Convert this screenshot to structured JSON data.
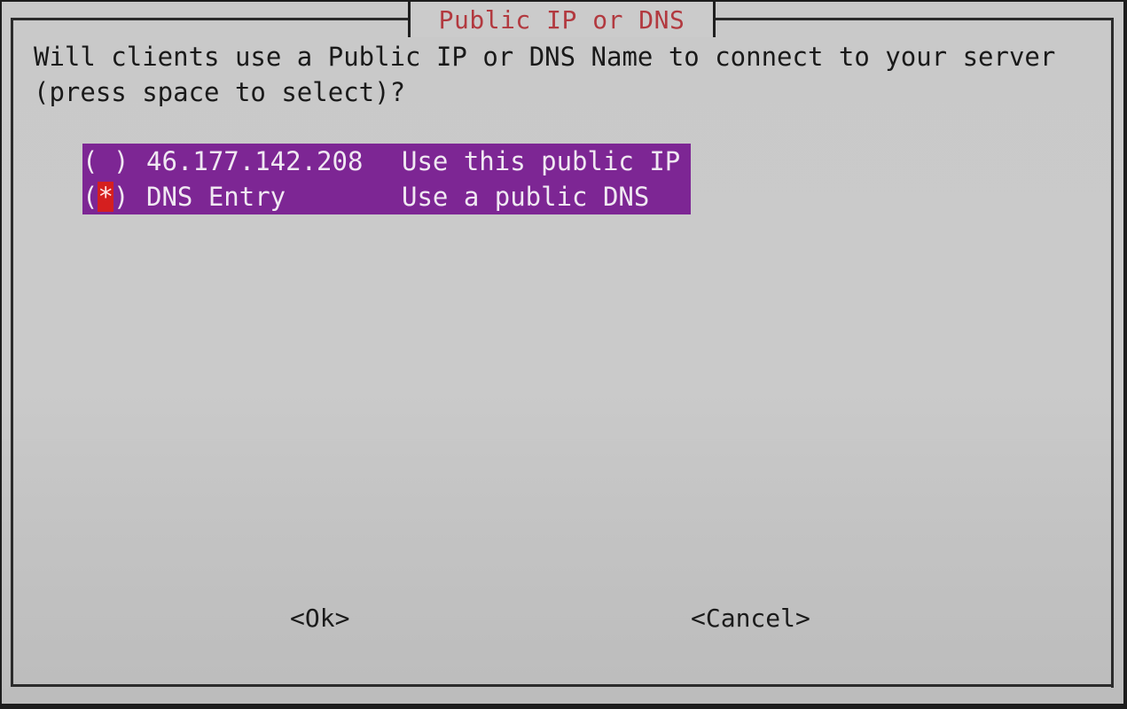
{
  "dialog": {
    "title": "Public IP or DNS",
    "prompt_line1": "Will clients use a Public IP or DNS Name to connect to your server",
    "prompt_line2": "(press space to select)?"
  },
  "options": [
    {
      "radio_open": "(",
      "radio_mark": " ",
      "radio_close": ")",
      "value": "46.177.142.208",
      "description": "Use this public IP",
      "selected": false
    },
    {
      "radio_open": "(",
      "radio_mark": "*",
      "radio_close": ")",
      "value": "DNS Entry",
      "description": "Use a public DNS",
      "selected": true
    }
  ],
  "buttons": {
    "ok_label": "<Ok>",
    "cancel_label": "<Cancel>"
  },
  "colors": {
    "title": "#b2393f",
    "list_background": "#7d2694",
    "selected_marker": "#d51f1f",
    "dialog_background": "#c9c9c9"
  }
}
